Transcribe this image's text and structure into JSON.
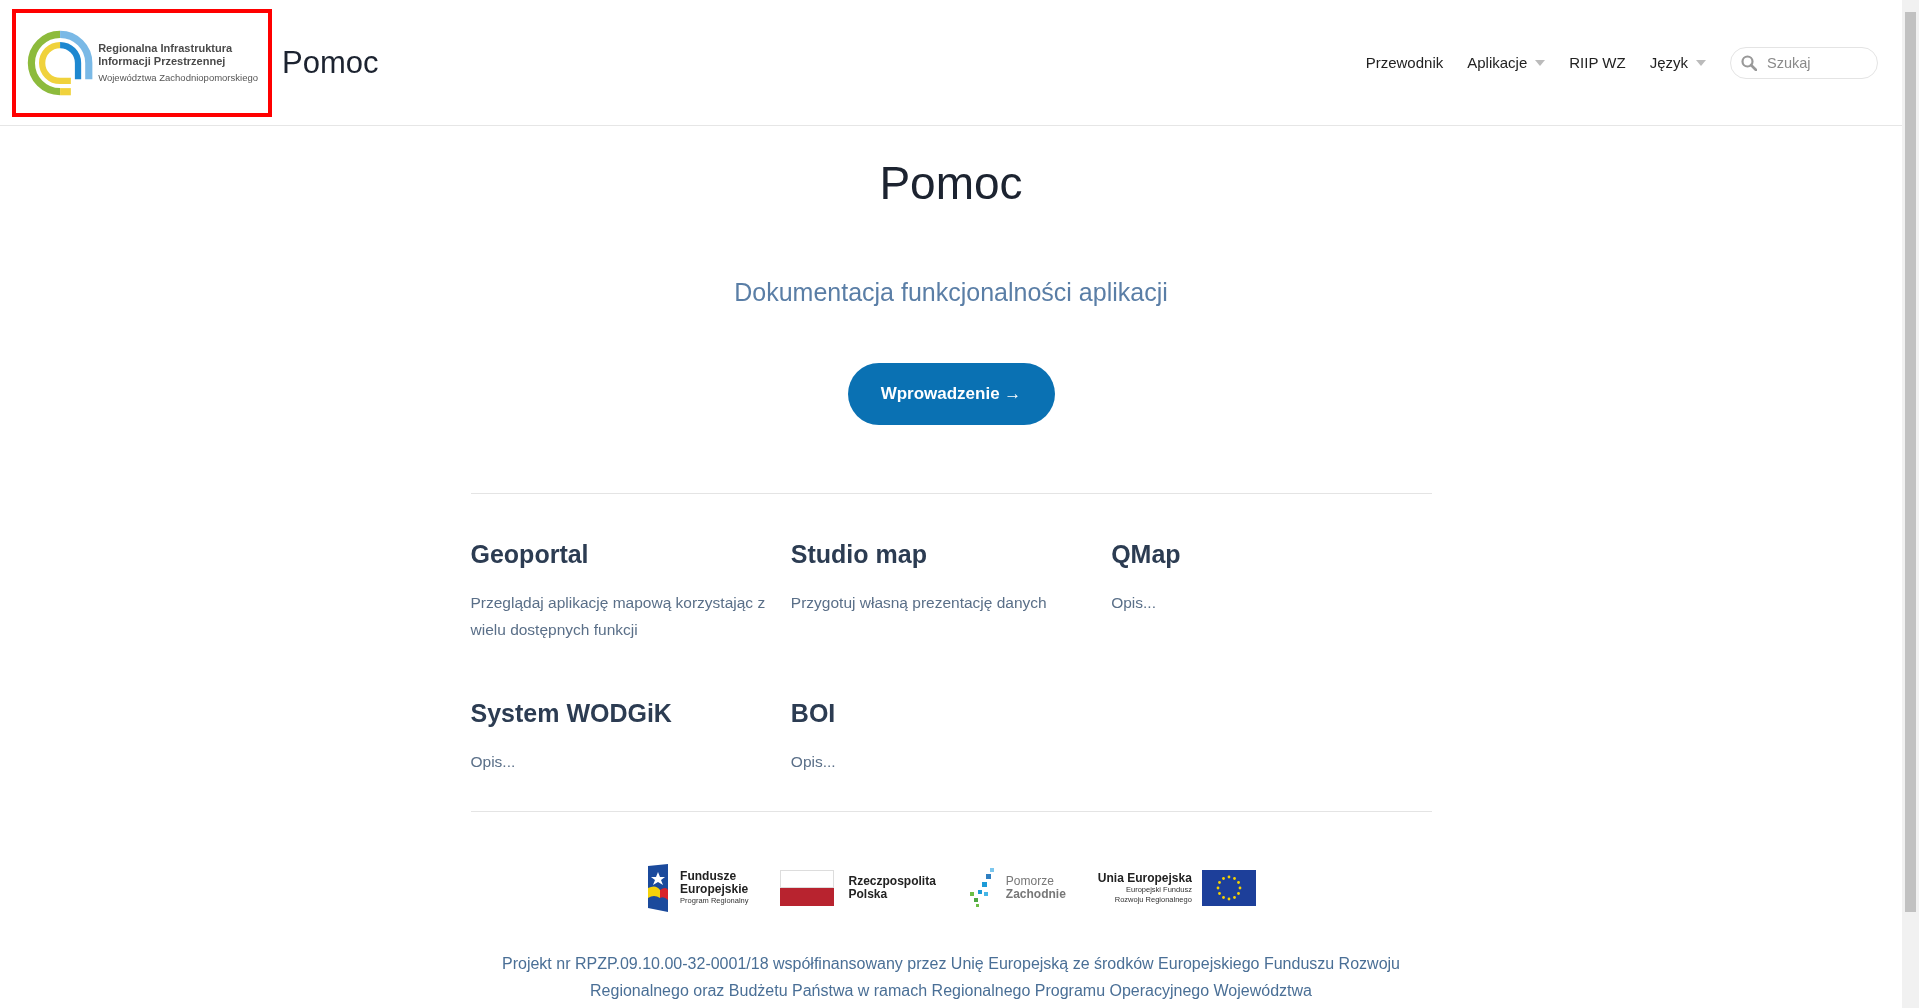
{
  "header": {
    "logo": {
      "lines": [
        "Regionalna Infrastruktura",
        "Informacji Przestrzennej"
      ],
      "subline": "Województwa Zachodniopomorskiego",
      "highlighted": true
    },
    "site_title": "Pomoc",
    "nav": [
      {
        "label": "Przewodnik",
        "dropdown": false
      },
      {
        "label": "Aplikacje",
        "dropdown": true
      },
      {
        "label": "RIIP WZ",
        "dropdown": false
      },
      {
        "label": "Język",
        "dropdown": true
      }
    ],
    "search": {
      "placeholder": "Szukaj"
    }
  },
  "hero": {
    "title": "Pomoc",
    "subtitle": "Dokumentacja funkcjonalności aplikacji",
    "button": "Wprowadzenie →"
  },
  "cards": [
    {
      "title": "Geoportal",
      "description": "Przeglądaj aplikację mapową korzystając z wielu dostępnych funkcji"
    },
    {
      "title": "Studio map",
      "description": "Przygotuj własną prezentację danych"
    },
    {
      "title": "QMap",
      "description": "Opis..."
    },
    {
      "title": "System WODGiK",
      "description": "Opis..."
    },
    {
      "title": "BOI",
      "description": "Opis..."
    }
  ],
  "footer": {
    "logos": [
      {
        "kind": "fe",
        "lines": [
          "Fundusze",
          "Europejskie"
        ],
        "small": [
          "Program Regionalny"
        ]
      },
      {
        "kind": "pl",
        "lines": [
          "Rzeczpospolita",
          "Polska"
        ]
      },
      {
        "kind": "pz",
        "lines": [
          "Pomorze",
          "Zachodnie"
        ]
      },
      {
        "kind": "eu",
        "lines": [
          "Unia Europejska"
        ],
        "small": [
          "Europejski Fundusz",
          "Rozwoju Regionalnego"
        ]
      }
    ],
    "text_lines": [
      "Projekt nr RPZP.09.10.00-32-0001/18 współfinansowany przez Unię Europejską ze środków Europejskiego Funduszu Rozwoju",
      "Regionalnego oraz Budżetu Państwa w ramach Regionalnego Programu Operacyjnego Województwa"
    ]
  }
}
